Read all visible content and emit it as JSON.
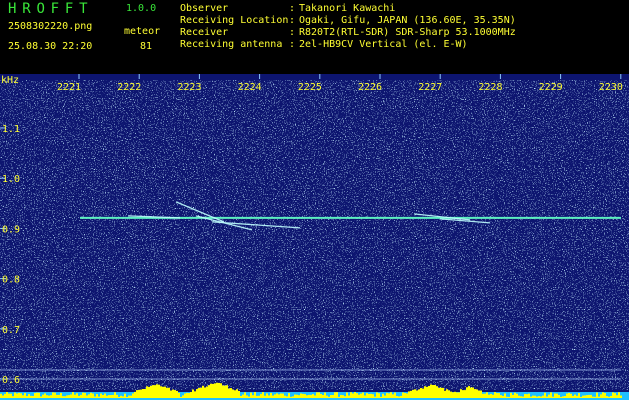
{
  "header": {
    "app_name": "HROFFT",
    "version": "1.0.0",
    "file_name": "2508302220.png",
    "date_time": "25.08.30 22:20",
    "event_type": "meteor",
    "event_count": "81",
    "info": [
      {
        "key": "Observer",
        "colon": ":",
        "value": "Takanori Kawachi"
      },
      {
        "key": "Receiving Location",
        "colon": ":",
        "value": "Ogaki, Gifu, JAPAN (136.60E, 35.35N)"
      },
      {
        "key": "Receiver",
        "colon": ":",
        "value": "R820T2(RTL-SDR) SDR-Sharp 53.1000MHz"
      },
      {
        "key": "Receiving antenna",
        "colon": ":",
        "value": "2el-HB9CV Vertical (el. E-W)"
      }
    ]
  },
  "spectrogram": {
    "y_unit": "kHz",
    "y_ticks": [
      "1.1",
      "1.0",
      "0.9",
      "0.8",
      "0.7",
      "0.6"
    ],
    "time_ticks": [
      "2221",
      "2222",
      "2223",
      "2224",
      "2225",
      "2226",
      "2227",
      "2228",
      "2229",
      "2230"
    ],
    "colors": {
      "background": "#0d1570",
      "carrier": "#5cf0c0",
      "label": "#ffff33",
      "axis": "#8fc8ff",
      "power_bar": "#ffff00",
      "power_floor": "#20c0ff"
    }
  }
}
